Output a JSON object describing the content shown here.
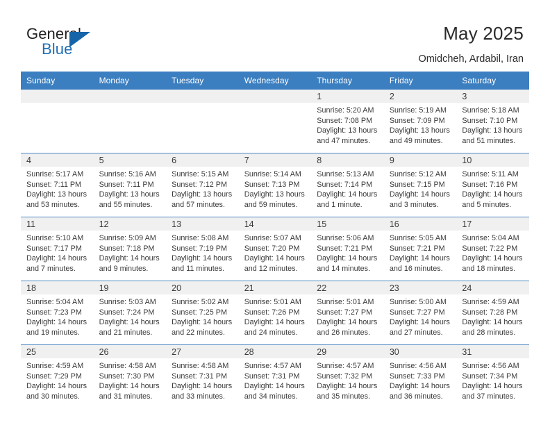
{
  "brand": {
    "name_part1": "General",
    "name_part2": "Blue",
    "flag_icon": "blue-triangle-flag-icon"
  },
  "header": {
    "title": "May 2025",
    "location": "Omidcheh, Ardabil, Iran"
  },
  "theme": {
    "header_blue": "#3c7fc1",
    "grid_line_blue": "#4a87c4",
    "daynum_band": "#f0f0f0",
    "brand_blue": "#1f6eb5",
    "text": "#3a3a3a"
  },
  "calendar": {
    "weekday_headers": [
      "Sunday",
      "Monday",
      "Tuesday",
      "Wednesday",
      "Thursday",
      "Friday",
      "Saturday"
    ],
    "weeks": [
      [
        {
          "empty": true
        },
        {
          "empty": true
        },
        {
          "empty": true
        },
        {
          "empty": true
        },
        {
          "day": "1",
          "sunrise": "Sunrise: 5:20 AM",
          "sunset": "Sunset: 7:08 PM",
          "daylight1": "Daylight: 13 hours",
          "daylight2": "and 47 minutes."
        },
        {
          "day": "2",
          "sunrise": "Sunrise: 5:19 AM",
          "sunset": "Sunset: 7:09 PM",
          "daylight1": "Daylight: 13 hours",
          "daylight2": "and 49 minutes."
        },
        {
          "day": "3",
          "sunrise": "Sunrise: 5:18 AM",
          "sunset": "Sunset: 7:10 PM",
          "daylight1": "Daylight: 13 hours",
          "daylight2": "and 51 minutes."
        }
      ],
      [
        {
          "day": "4",
          "sunrise": "Sunrise: 5:17 AM",
          "sunset": "Sunset: 7:11 PM",
          "daylight1": "Daylight: 13 hours",
          "daylight2": "and 53 minutes."
        },
        {
          "day": "5",
          "sunrise": "Sunrise: 5:16 AM",
          "sunset": "Sunset: 7:11 PM",
          "daylight1": "Daylight: 13 hours",
          "daylight2": "and 55 minutes."
        },
        {
          "day": "6",
          "sunrise": "Sunrise: 5:15 AM",
          "sunset": "Sunset: 7:12 PM",
          "daylight1": "Daylight: 13 hours",
          "daylight2": "and 57 minutes."
        },
        {
          "day": "7",
          "sunrise": "Sunrise: 5:14 AM",
          "sunset": "Sunset: 7:13 PM",
          "daylight1": "Daylight: 13 hours",
          "daylight2": "and 59 minutes."
        },
        {
          "day": "8",
          "sunrise": "Sunrise: 5:13 AM",
          "sunset": "Sunset: 7:14 PM",
          "daylight1": "Daylight: 14 hours",
          "daylight2": "and 1 minute."
        },
        {
          "day": "9",
          "sunrise": "Sunrise: 5:12 AM",
          "sunset": "Sunset: 7:15 PM",
          "daylight1": "Daylight: 14 hours",
          "daylight2": "and 3 minutes."
        },
        {
          "day": "10",
          "sunrise": "Sunrise: 5:11 AM",
          "sunset": "Sunset: 7:16 PM",
          "daylight1": "Daylight: 14 hours",
          "daylight2": "and 5 minutes."
        }
      ],
      [
        {
          "day": "11",
          "sunrise": "Sunrise: 5:10 AM",
          "sunset": "Sunset: 7:17 PM",
          "daylight1": "Daylight: 14 hours",
          "daylight2": "and 7 minutes."
        },
        {
          "day": "12",
          "sunrise": "Sunrise: 5:09 AM",
          "sunset": "Sunset: 7:18 PM",
          "daylight1": "Daylight: 14 hours",
          "daylight2": "and 9 minutes."
        },
        {
          "day": "13",
          "sunrise": "Sunrise: 5:08 AM",
          "sunset": "Sunset: 7:19 PM",
          "daylight1": "Daylight: 14 hours",
          "daylight2": "and 11 minutes."
        },
        {
          "day": "14",
          "sunrise": "Sunrise: 5:07 AM",
          "sunset": "Sunset: 7:20 PM",
          "daylight1": "Daylight: 14 hours",
          "daylight2": "and 12 minutes."
        },
        {
          "day": "15",
          "sunrise": "Sunrise: 5:06 AM",
          "sunset": "Sunset: 7:21 PM",
          "daylight1": "Daylight: 14 hours",
          "daylight2": "and 14 minutes."
        },
        {
          "day": "16",
          "sunrise": "Sunrise: 5:05 AM",
          "sunset": "Sunset: 7:21 PM",
          "daylight1": "Daylight: 14 hours",
          "daylight2": "and 16 minutes."
        },
        {
          "day": "17",
          "sunrise": "Sunrise: 5:04 AM",
          "sunset": "Sunset: 7:22 PM",
          "daylight1": "Daylight: 14 hours",
          "daylight2": "and 18 minutes."
        }
      ],
      [
        {
          "day": "18",
          "sunrise": "Sunrise: 5:04 AM",
          "sunset": "Sunset: 7:23 PM",
          "daylight1": "Daylight: 14 hours",
          "daylight2": "and 19 minutes."
        },
        {
          "day": "19",
          "sunrise": "Sunrise: 5:03 AM",
          "sunset": "Sunset: 7:24 PM",
          "daylight1": "Daylight: 14 hours",
          "daylight2": "and 21 minutes."
        },
        {
          "day": "20",
          "sunrise": "Sunrise: 5:02 AM",
          "sunset": "Sunset: 7:25 PM",
          "daylight1": "Daylight: 14 hours",
          "daylight2": "and 22 minutes."
        },
        {
          "day": "21",
          "sunrise": "Sunrise: 5:01 AM",
          "sunset": "Sunset: 7:26 PM",
          "daylight1": "Daylight: 14 hours",
          "daylight2": "and 24 minutes."
        },
        {
          "day": "22",
          "sunrise": "Sunrise: 5:01 AM",
          "sunset": "Sunset: 7:27 PM",
          "daylight1": "Daylight: 14 hours",
          "daylight2": "and 26 minutes."
        },
        {
          "day": "23",
          "sunrise": "Sunrise: 5:00 AM",
          "sunset": "Sunset: 7:27 PM",
          "daylight1": "Daylight: 14 hours",
          "daylight2": "and 27 minutes."
        },
        {
          "day": "24",
          "sunrise": "Sunrise: 4:59 AM",
          "sunset": "Sunset: 7:28 PM",
          "daylight1": "Daylight: 14 hours",
          "daylight2": "and 28 minutes."
        }
      ],
      [
        {
          "day": "25",
          "sunrise": "Sunrise: 4:59 AM",
          "sunset": "Sunset: 7:29 PM",
          "daylight1": "Daylight: 14 hours",
          "daylight2": "and 30 minutes."
        },
        {
          "day": "26",
          "sunrise": "Sunrise: 4:58 AM",
          "sunset": "Sunset: 7:30 PM",
          "daylight1": "Daylight: 14 hours",
          "daylight2": "and 31 minutes."
        },
        {
          "day": "27",
          "sunrise": "Sunrise: 4:58 AM",
          "sunset": "Sunset: 7:31 PM",
          "daylight1": "Daylight: 14 hours",
          "daylight2": "and 33 minutes."
        },
        {
          "day": "28",
          "sunrise": "Sunrise: 4:57 AM",
          "sunset": "Sunset: 7:31 PM",
          "daylight1": "Daylight: 14 hours",
          "daylight2": "and 34 minutes."
        },
        {
          "day": "29",
          "sunrise": "Sunrise: 4:57 AM",
          "sunset": "Sunset: 7:32 PM",
          "daylight1": "Daylight: 14 hours",
          "daylight2": "and 35 minutes."
        },
        {
          "day": "30",
          "sunrise": "Sunrise: 4:56 AM",
          "sunset": "Sunset: 7:33 PM",
          "daylight1": "Daylight: 14 hours",
          "daylight2": "and 36 minutes."
        },
        {
          "day": "31",
          "sunrise": "Sunrise: 4:56 AM",
          "sunset": "Sunset: 7:34 PM",
          "daylight1": "Daylight: 14 hours",
          "daylight2": "and 37 minutes."
        }
      ]
    ]
  }
}
